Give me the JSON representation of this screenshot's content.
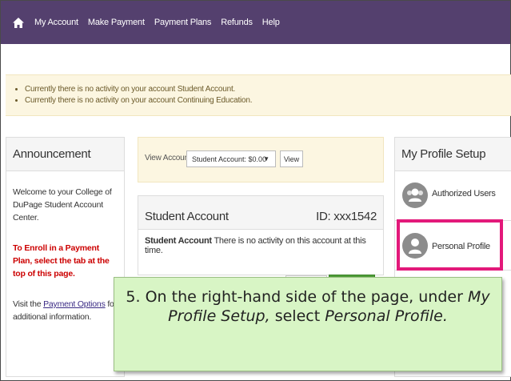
{
  "nav": {
    "home_icon": "home-icon",
    "links": [
      "My Account",
      "Make Payment",
      "Payment Plans",
      "Refunds",
      "Help"
    ]
  },
  "alert": {
    "messages": [
      "Currently there is no activity on your account Student Account.",
      "Currently there is no activity on your account Continuing Education."
    ]
  },
  "announcement": {
    "title": "Announcement",
    "welcome": "Welcome to your College of DuPage Student Account Center.",
    "enroll": "To Enroll in a Payment Plan, select the tab at the top of this page.",
    "visit_prefix": "Visit the ",
    "visit_link": "Payment Options",
    "visit_suffix": " for additional information."
  },
  "view_account": {
    "label": "View Account:",
    "selected": "Student Account: $0.00",
    "button": "View"
  },
  "student_account": {
    "title": "Student Account",
    "id": "ID: xxx1542",
    "msg_bold": "Student Account",
    "msg_rest": " There is no activity on this account at this time."
  },
  "profile_setup": {
    "title": "My Profile Setup",
    "items": [
      "Authorized Users",
      "Personal Profile"
    ]
  },
  "callout": {
    "part1": "5. On the right-hand side of the page, under ",
    "part2": "My Profile Setup,",
    "part3": " select ",
    "part4": "Personal Profile."
  },
  "colors": {
    "nav_bg": "#54406e",
    "alert_bg": "#fcf6e1",
    "highlight": "#e3197a",
    "callout_bg": "#d8f5c5",
    "enroll_text": "#cc0000"
  }
}
